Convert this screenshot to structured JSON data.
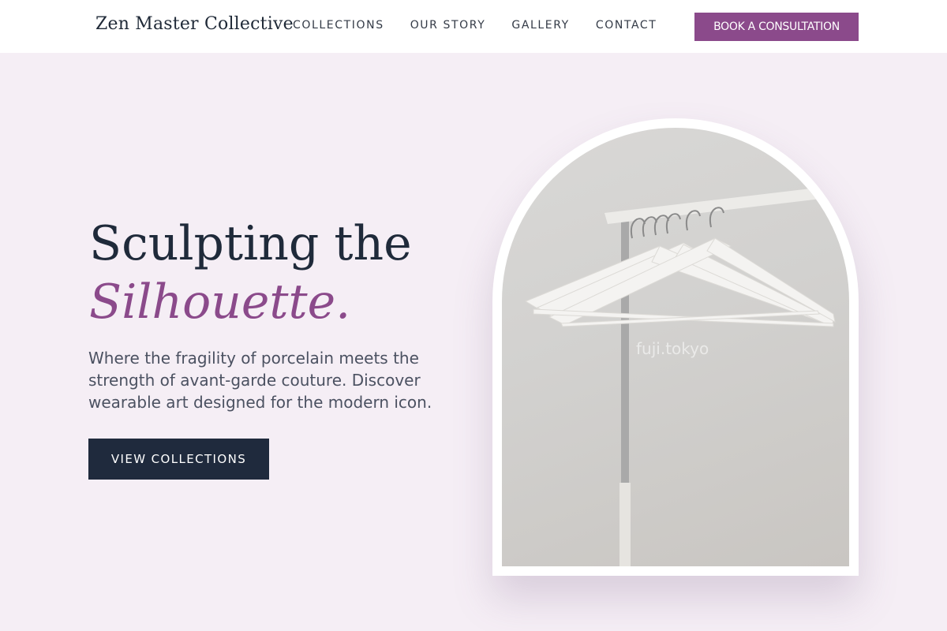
{
  "header": {
    "brand": "Zen Master Collective",
    "nav": [
      "COLLECTIONS",
      "OUR STORY",
      "GALLERY",
      "CONTACT"
    ],
    "cta": "BOOK A CONSULTATION"
  },
  "hero": {
    "title_line1": "Sculpting the",
    "title_line2": "Silhouette.",
    "description": "Where the fragility of porcelain meets the strength of avant-garde couture. Discover wearable art designed for the modern icon.",
    "cta": "VIEW COLLECTIONS"
  },
  "image": {
    "subject": "white clothes hangers on a garment rack",
    "watermark": "fuji.tokyo"
  },
  "colors": {
    "accent": "#8b4a8b",
    "navy": "#1f2a3d",
    "background": "#f5eef5"
  }
}
